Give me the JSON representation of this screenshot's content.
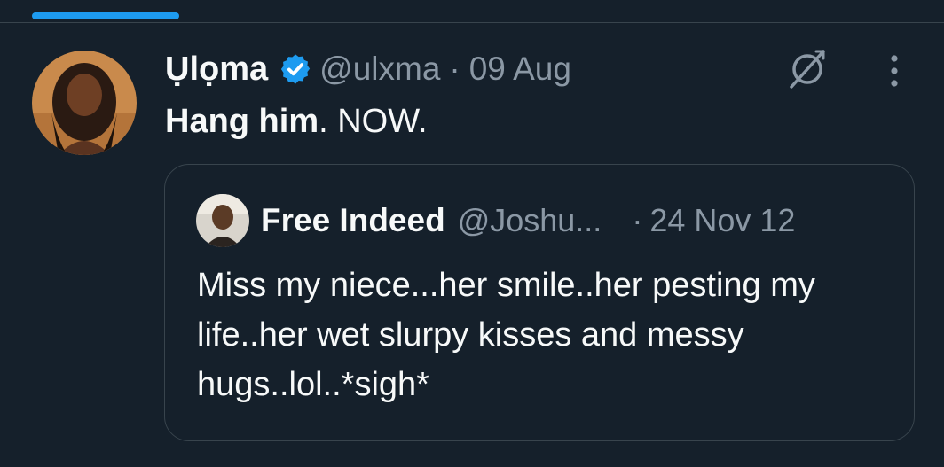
{
  "tweet": {
    "author": {
      "name": "Ụlọma",
      "handle": "@ulxma",
      "verified": true,
      "avatar_icon": "profile-photo"
    },
    "separator": "·",
    "date": "09 Aug",
    "text_bold": "Hang him",
    "text_rest": ". NOW.",
    "icons": {
      "grok": "grok-icon",
      "more": "more-vertical-icon"
    }
  },
  "quote": {
    "author": {
      "name": "Free Indeed",
      "handle": "@Joshu...",
      "avatar_icon": "profile-photo"
    },
    "separator": "·",
    "date": "24 Nov 12",
    "text": "Miss my niece...her smile..her pesting my life..her wet slurpy kisses and messy hugs..lol..*sigh*"
  },
  "colors": {
    "background": "#15202b",
    "accent": "#1d9bf0",
    "text_primary": "#f7f9f9",
    "text_secondary": "#8b98a5",
    "border": "#38444d"
  }
}
